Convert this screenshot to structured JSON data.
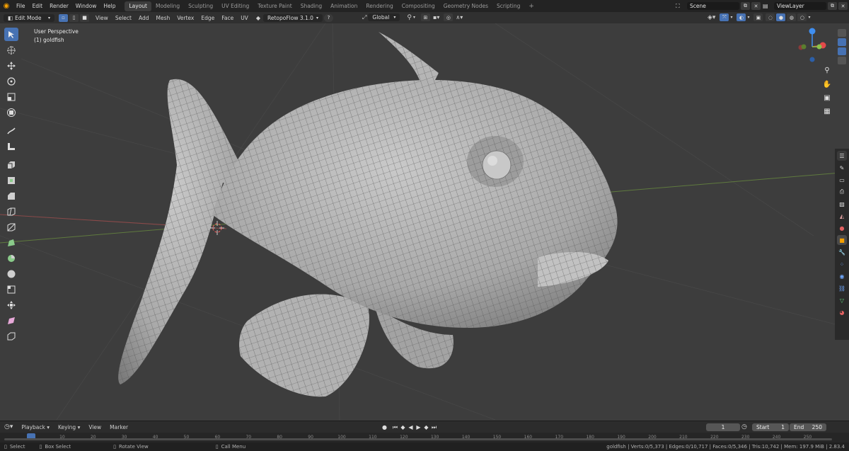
{
  "topbar": {
    "menus": [
      "File",
      "Edit",
      "Render",
      "Window",
      "Help"
    ],
    "workspaces": [
      "Layout",
      "Modeling",
      "Sculpting",
      "UV Editing",
      "Texture Paint",
      "Shading",
      "Animation",
      "Rendering",
      "Compositing",
      "Geometry Nodes",
      "Scripting"
    ],
    "active_workspace": "Layout",
    "add_tab": "+",
    "scene_name": "Scene",
    "view_layer": "ViewLayer"
  },
  "header": {
    "mode": "Edit Mode",
    "menus": [
      "View",
      "Select",
      "Add",
      "Mesh",
      "Vertex",
      "Edge",
      "Face",
      "UV"
    ],
    "addon": "RetopoFlow 3.1.0",
    "orientation": "Global"
  },
  "viewport": {
    "perspective": "User Perspective",
    "object": "(1) goldfish",
    "axis_labels": {
      "x": "X",
      "y": "Y",
      "z": "Z"
    }
  },
  "timeline": {
    "menus": [
      "Playback",
      "Keying",
      "View",
      "Marker"
    ],
    "current_frame": "1",
    "start_label": "Start",
    "start_value": "1",
    "end_label": "End",
    "end_value": "250",
    "ticks": [
      "0",
      "10",
      "20",
      "30",
      "40",
      "50",
      "60",
      "70",
      "80",
      "90",
      "100",
      "110",
      "120",
      "130",
      "140",
      "150",
      "160",
      "170",
      "180",
      "190",
      "200",
      "210",
      "220",
      "230",
      "240",
      "250"
    ]
  },
  "status": {
    "select": "Select",
    "box_select": "Box Select",
    "rotate_view": "Rotate View",
    "call_menu": "Call Menu",
    "stats": "goldfish | Verts:0/5,373 | Edges:0/10,717 | Faces:0/5,346 | Tris:10,742 | Mem: 197.9 MiB | 2.83.4"
  },
  "colors": {
    "accent": "#4772b3",
    "viewport_bg": "#3d3d3d",
    "axis_x": "#e24a4a",
    "axis_y": "#8bc34a",
    "axis_z": "#3f8ef0"
  }
}
